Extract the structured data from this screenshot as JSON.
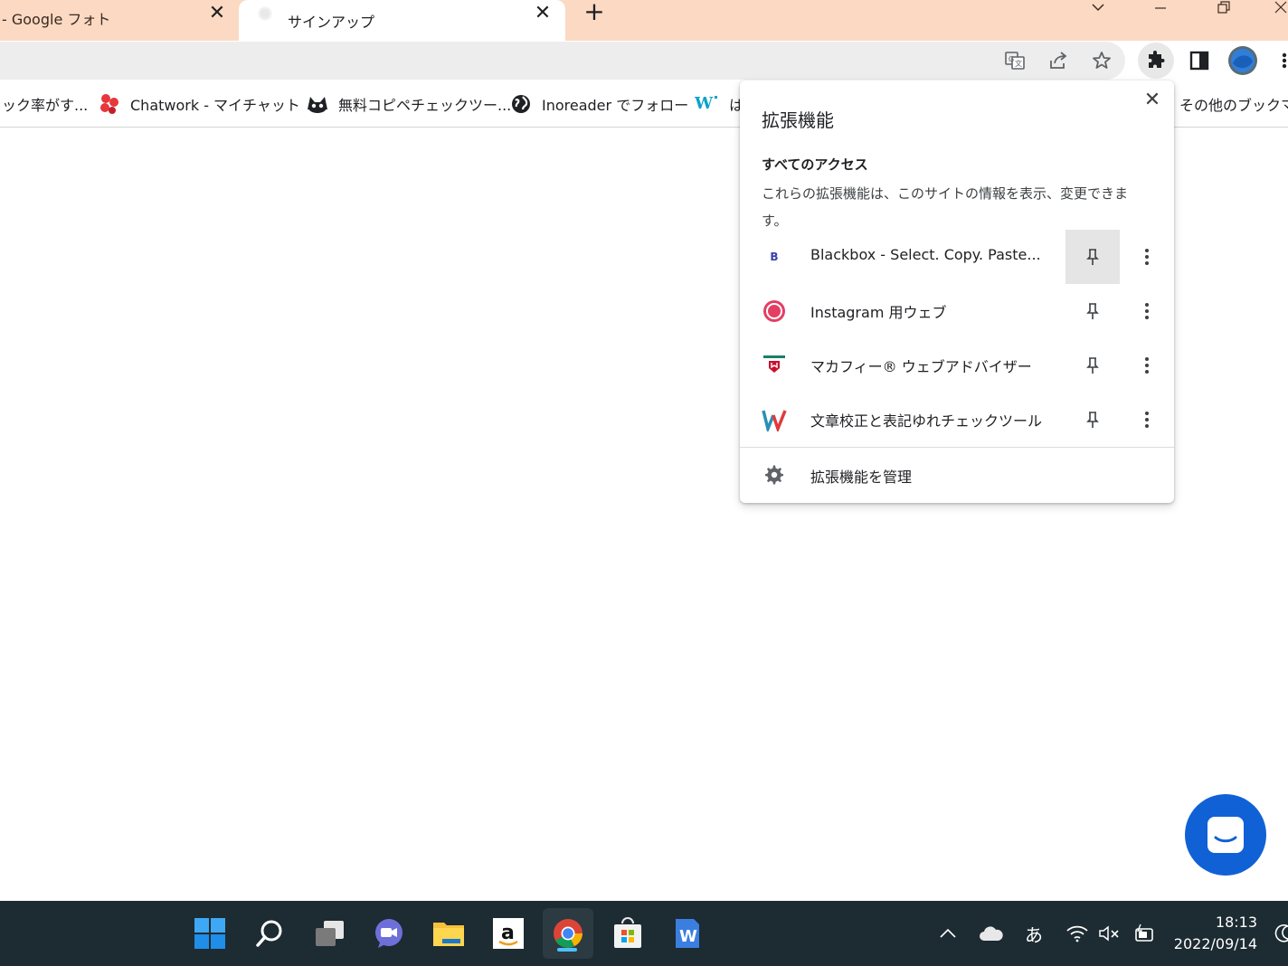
{
  "browser": {
    "tabs": [
      {
        "label": "- Google フォト",
        "close": "✕"
      },
      {
        "label": "サインアップ",
        "close": "✕"
      }
    ],
    "new_tab": "+",
    "bookmarks": [
      {
        "label": "ック率がす..."
      },
      {
        "label": "Chatwork - マイチャット"
      },
      {
        "label": "無料コピペチェックツー..."
      },
      {
        "label": "Inoreader でフォロー"
      },
      {
        "label": "は"
      },
      {
        "label": "その他のブックマー"
      }
    ]
  },
  "extensions_popup": {
    "title": "拡張機能",
    "close": "✕",
    "section_title": "すべてのアクセス",
    "section_desc": "これらの拡張機能は、このサイトの情報を表示、変更できます。",
    "items": [
      {
        "name": "Blackbox - Select. Copy. Paste...",
        "icon_letter": "B"
      },
      {
        "name": "Instagram 用ウェブ"
      },
      {
        "name": "マカフィー® ウェブアドバイザー"
      },
      {
        "name": "文章校正と表記ゆれチェックツール"
      }
    ],
    "manage_label": "拡張機能を管理"
  },
  "taskbar": {
    "ime": "あ",
    "time": "18:13",
    "date": "2022/09/14"
  },
  "colors": {
    "tabstrip": "#fbd9c3",
    "taskbar": "#1d2b32",
    "chat_fab": "#1061d6",
    "accent": "#4cc2ff"
  }
}
